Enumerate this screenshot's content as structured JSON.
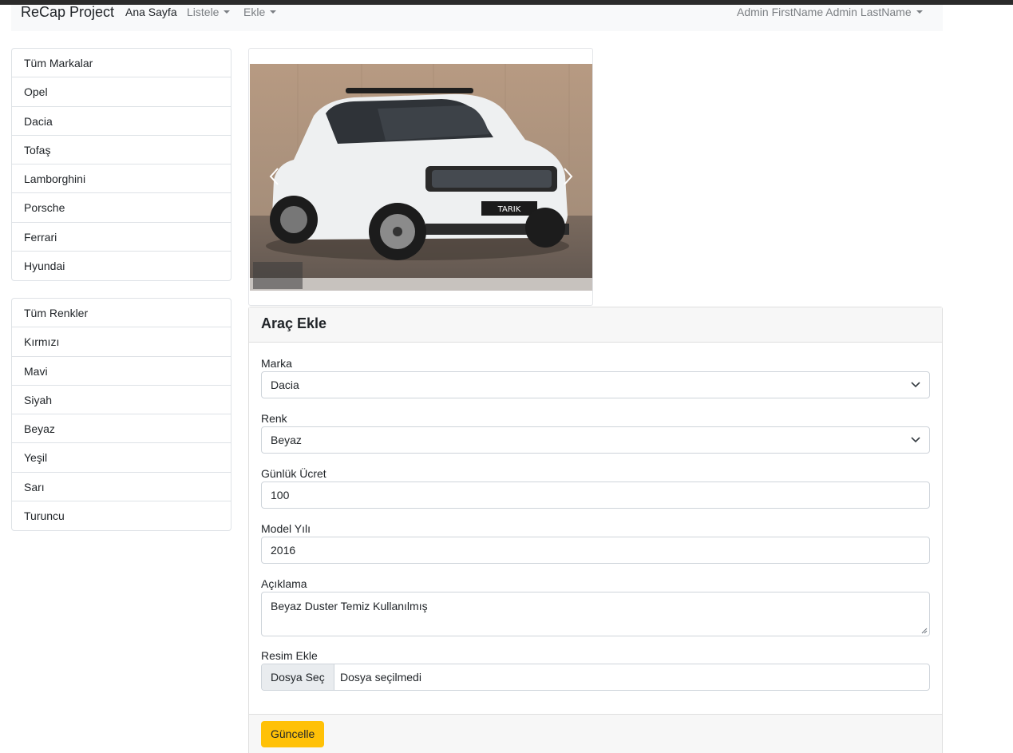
{
  "navbar": {
    "brand": "ReCap Project",
    "items": [
      {
        "label": "Ana Sayfa",
        "active": true,
        "dropdown": false
      },
      {
        "label": "Listele",
        "active": false,
        "dropdown": true
      },
      {
        "label": "Ekle",
        "active": false,
        "dropdown": true
      }
    ],
    "user_menu": "Admin FirstName Admin LastName"
  },
  "brands": [
    "Tüm Markalar",
    "Opel",
    "Dacia",
    "Tofaş",
    "Lamborghini",
    "Porsche",
    "Ferrari",
    "Hyundai"
  ],
  "colors": [
    "Tüm Renkler",
    "Kırmızı",
    "Mavi",
    "Siyah",
    "Beyaz",
    "Yeşil",
    "Sarı",
    "Turuncu"
  ],
  "carousel": {
    "prev_icon": "chevron-left-icon",
    "next_icon": "chevron-right-icon"
  },
  "form": {
    "title": "Araç Ekle",
    "brand": {
      "label": "Marka",
      "value": "Dacia"
    },
    "color": {
      "label": "Renk",
      "value": "Beyaz"
    },
    "daily_price": {
      "label": "Günlük Ücret",
      "value": "100"
    },
    "model_year": {
      "label": "Model Yılı",
      "value": "2016"
    },
    "description": {
      "label": "Açıklama",
      "value": "Beyaz Duster Temiz Kullanılmış"
    },
    "image": {
      "label": "Resim Ekle",
      "button": "Dosya Seç",
      "status": "Dosya seçilmedi"
    },
    "submit": "Güncelle"
  },
  "theme": {
    "accent": "#ffc107",
    "navbar_bg": "#f8f9fa",
    "border": "#dee2e6"
  }
}
